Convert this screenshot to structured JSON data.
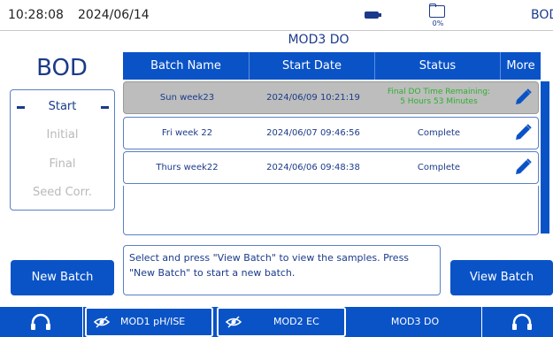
{
  "status_bar": {
    "time": "10:28:08",
    "date": "2024/06/14",
    "storage_percent": "0%",
    "app_name": "BOD"
  },
  "module_title": "MOD3 DO",
  "page_title": "BOD",
  "steps": {
    "start": "Start",
    "initial": "Initial",
    "final": "Final",
    "seed_corr": "Seed Corr."
  },
  "table": {
    "headers": {
      "batch_name": "Batch Name",
      "start_date": "Start Date",
      "status": "Status",
      "more": "More"
    },
    "rows": [
      {
        "batch_name": "Sun week23",
        "start_date": "2024/06/09 10:21:19",
        "status_line1": "Final DO Time Remaining:",
        "status_line2": "5 Hours 53 Minutes",
        "selected": true
      },
      {
        "batch_name": "Fri week 22",
        "start_date": "2024/06/07 09:46:56",
        "status": "Complete",
        "selected": false
      },
      {
        "batch_name": "Thurs week22",
        "start_date": "2024/06/06 09:48:38",
        "status": "Complete",
        "selected": false
      }
    ]
  },
  "message": "Select and press \"View Batch\" to view the samples. Press \"New Batch\" to start a new batch.",
  "buttons": {
    "new_batch": "New Batch",
    "view_batch": "View Batch"
  },
  "bottom_nav": {
    "mod1": "MOD1 pH/ISE",
    "mod2": "MOD2 EC",
    "mod3": "MOD3 DO"
  },
  "colors": {
    "accent": "#0a53c7",
    "text_dark_blue": "#1b3a8a",
    "status_green": "#2db02d",
    "selected_row": "#bdbdbd"
  },
  "icons": [
    "battery-icon",
    "folder-icon",
    "pencil-icon",
    "headset-icon",
    "eye-hidden-icon"
  ]
}
